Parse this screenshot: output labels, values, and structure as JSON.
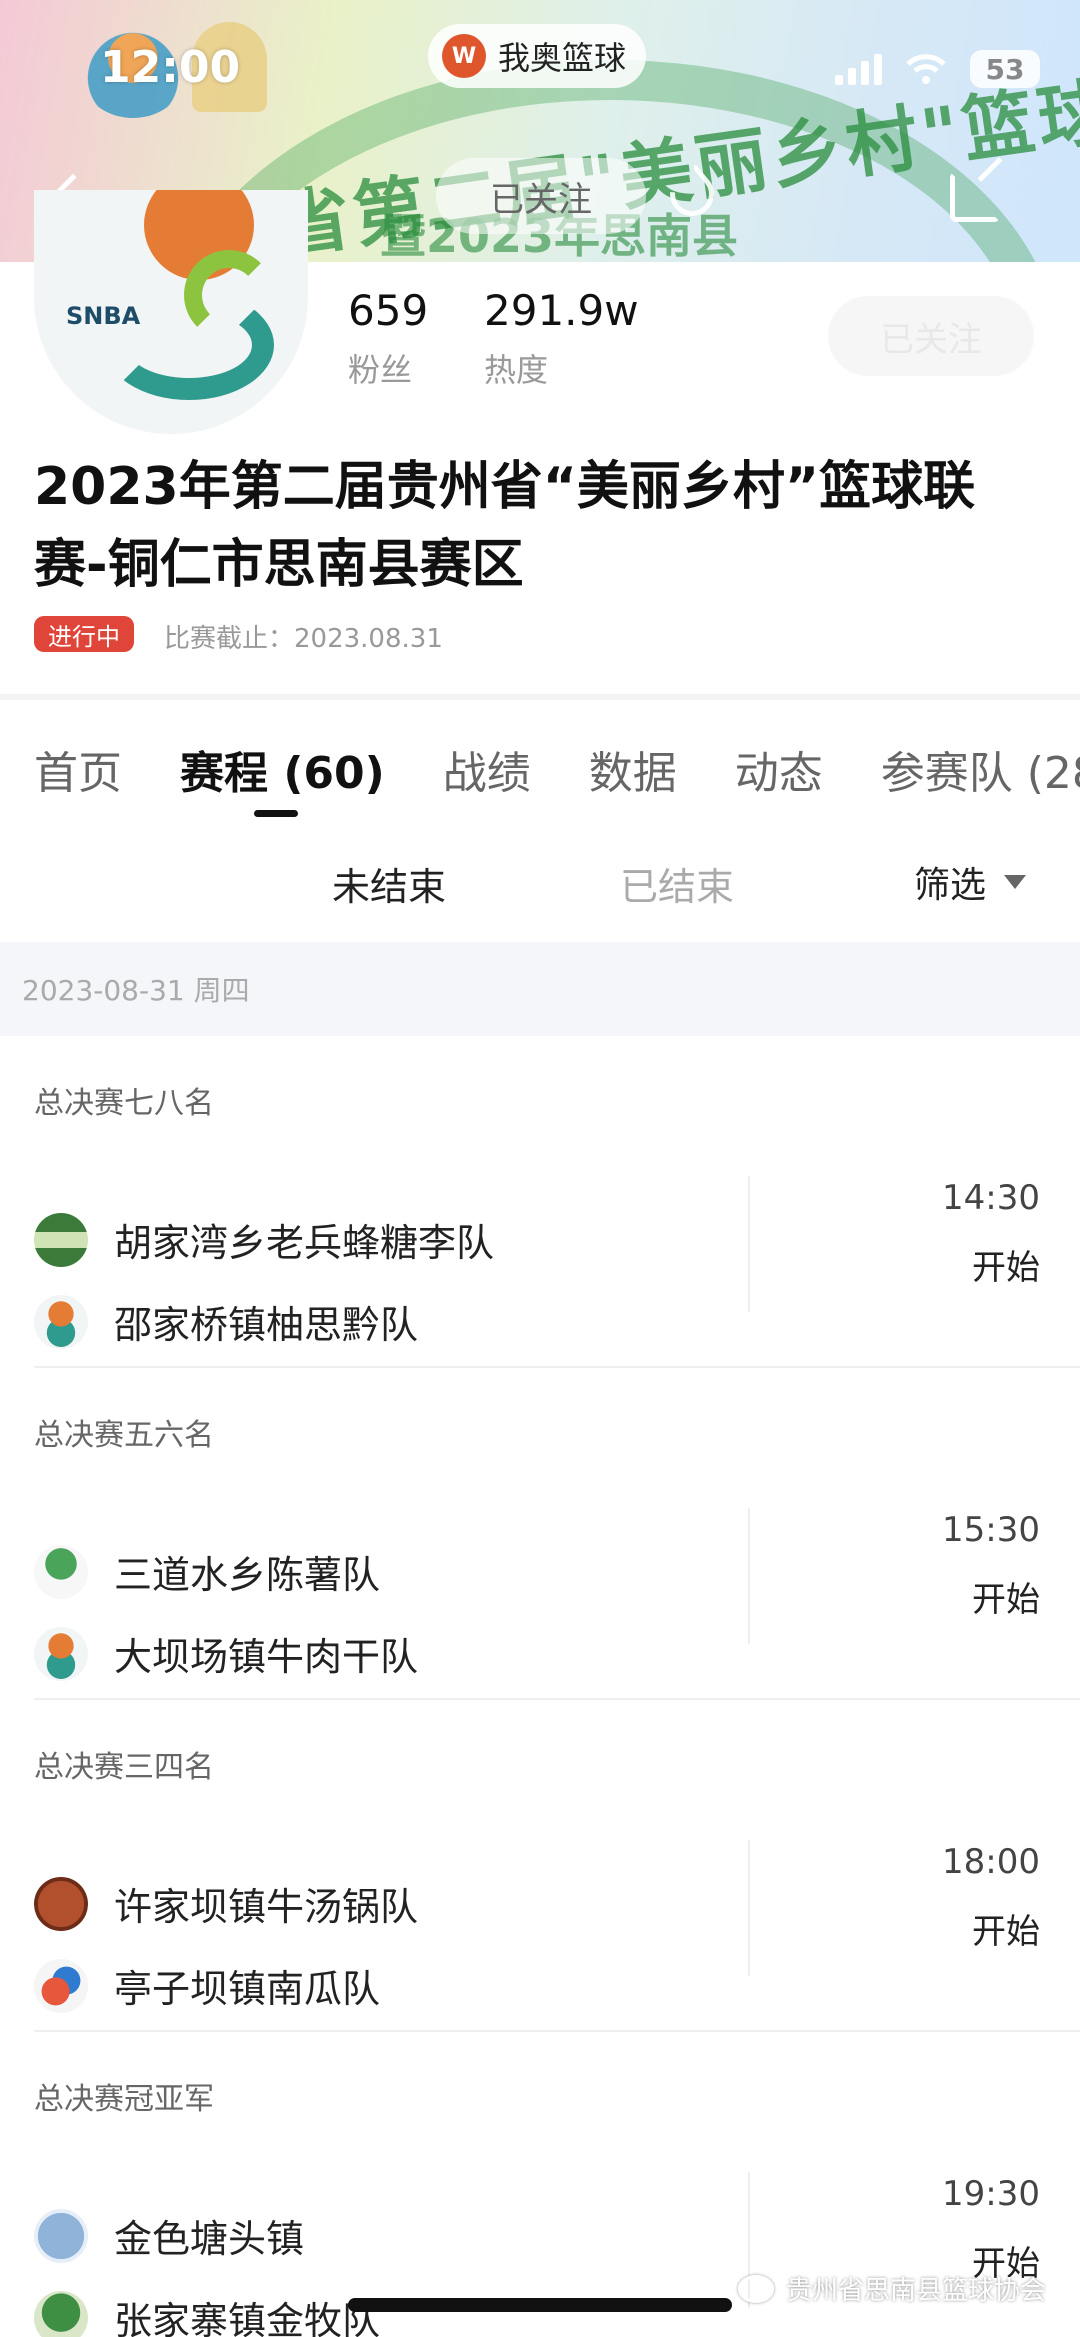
{
  "status_bar": {
    "time": "12:00",
    "battery": "53"
  },
  "app_pill": {
    "name": "我奥篮球"
  },
  "header": {
    "banner_text": "省第二届\"美丽乡村\"篮球联赛预选赛（思南县",
    "banner_sub": "暨2023年思南县",
    "follow_pill": "已关注"
  },
  "profile": {
    "avatar_text": "SNBA",
    "fans_value": "659",
    "fans_label": "粉丝",
    "heat_value": "291.9w",
    "heat_label": "热度",
    "follow_button": "已关注",
    "title": "2023年第二届贵州省“美丽乡村”篮球联赛-铜仁市思南县赛区",
    "status": "进行中",
    "deadline": "比赛截止：2023.08.31"
  },
  "tabs": [
    {
      "label": "首页"
    },
    {
      "label": "赛程 (60)"
    },
    {
      "label": "战绩"
    },
    {
      "label": "数据"
    },
    {
      "label": "动态"
    },
    {
      "label": "参赛队 (28"
    }
  ],
  "subtabs": {
    "open": "未结束",
    "closed": "已结束",
    "filter": "筛选"
  },
  "date_header": "2023-08-31 周四",
  "matches": [
    {
      "round": "总决赛七八名",
      "team_a": "胡家湾乡老兵蜂糖李队",
      "team_b": "邵家桥镇柚思黔队",
      "time": "14:30",
      "status": "开始"
    },
    {
      "round": "总决赛五六名",
      "team_a": "三道水乡陈薯队",
      "team_b": "大坝场镇牛肉干队",
      "time": "15:30",
      "status": "开始"
    },
    {
      "round": "总决赛三四名",
      "team_a": "许家坝镇牛汤锅队",
      "team_b": "亭子坝镇南瓜队",
      "time": "18:00",
      "status": "开始"
    },
    {
      "round": "总决赛冠亚军",
      "team_a": "金色塘头镇",
      "team_b": "张家寨镇金牧队",
      "time": "19:30",
      "status": "开始"
    }
  ],
  "watermark": "贵州省思南县篮球协会"
}
